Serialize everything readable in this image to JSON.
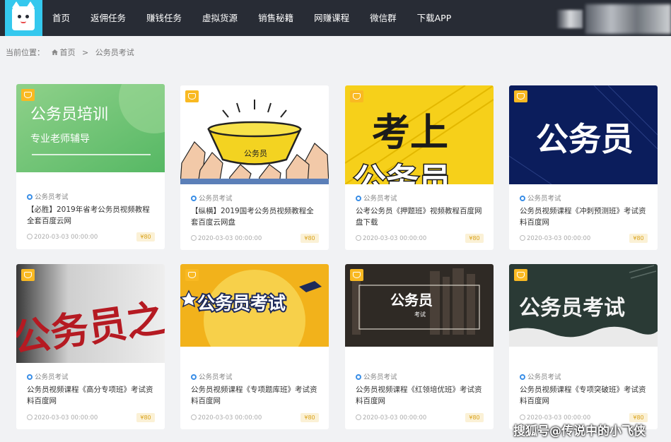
{
  "nav": {
    "items": [
      "首页",
      "返佣任务",
      "赚钱任务",
      "虚拟货源",
      "销售秘籍",
      "网赚课程",
      "微信群",
      "下载APP"
    ]
  },
  "breadcrumb": {
    "prefix": "当前位置：",
    "home": "首页",
    "separator": ">",
    "current": "公务员考试"
  },
  "cards": [
    {
      "category": "公务员考试",
      "title": "【必胜】2019年省考公务员视频教程全套百度云网",
      "date": "2020-03-03 00:00:00",
      "price": "¥80",
      "thumb_text": [
        "公务员培训",
        "专业老师辅导"
      ]
    },
    {
      "category": "公务员考试",
      "title": "【纵横】2019国考公务员视频教程全套百度云网盘",
      "date": "2020-03-03 00:00:00",
      "price": "¥80",
      "thumb_text": [
        "公务员"
      ]
    },
    {
      "category": "公务员考试",
      "title": "公考公务员《押题班》视频教程百度网盘下载",
      "date": "2020-03-03 00:00:00",
      "price": "¥80",
      "thumb_text": [
        "考上",
        "公务员"
      ]
    },
    {
      "category": "公务员考试",
      "title": "公务员视频课程《冲刺预测班》考试资料百度网",
      "date": "2020-03-03 00:00:00",
      "price": "¥80",
      "thumb_text": [
        "公务员"
      ]
    },
    {
      "category": "公务员考试",
      "title": "公务员视频课程《高分专项班》考试资料百度网",
      "date": "2020-03-03 00:00:00",
      "price": "¥80",
      "thumb_text": [
        "公务员之"
      ]
    },
    {
      "category": "公务员考试",
      "title": "公务员视频课程《专项题库班》考试资料百度网",
      "date": "2020-03-03 00:00:00",
      "price": "¥80",
      "thumb_text": [
        "公务员考试"
      ]
    },
    {
      "category": "公务员考试",
      "title": "公务员视频课程《红领培优班》考试资料百度网",
      "date": "2020-03-03 00:00:00",
      "price": "¥80",
      "thumb_text": [
        "公务员",
        "考试"
      ]
    },
    {
      "category": "公务员考试",
      "title": "公务员视频课程《专项突破班》考试资料百度网",
      "date": "2020-03-03 00:00:00",
      "price": "¥80",
      "thumb_text": [
        "公务员考试"
      ]
    }
  ],
  "watermark": "搜狐号@传说中的小飞侠",
  "colors": {
    "header": "#282c35",
    "logo": "#34c8ee",
    "badge": "#f9b922",
    "background": "#f1f2f4"
  }
}
